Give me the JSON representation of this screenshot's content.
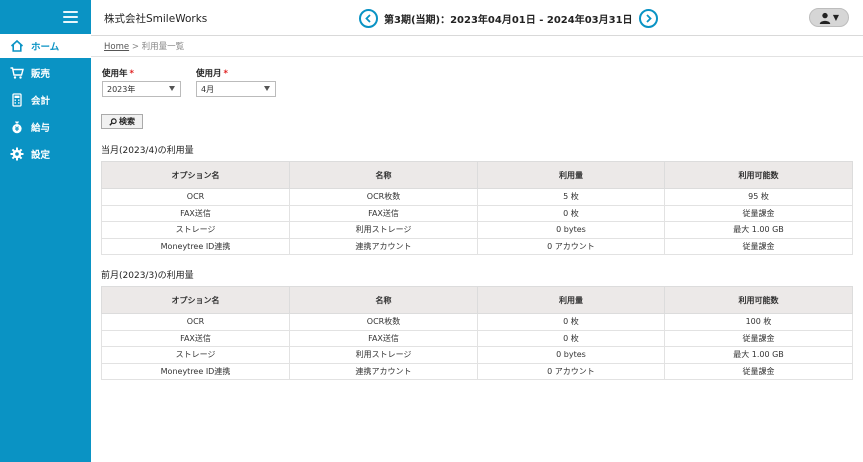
{
  "header": {
    "company": "株式会社SmileWorks",
    "period": "第3期(当期)：2023年04月01日 - 2024年03月31日"
  },
  "sidebar": {
    "items": [
      {
        "label": "ホーム",
        "icon": "home-icon"
      },
      {
        "label": "販売",
        "icon": "cart-icon"
      },
      {
        "label": "会計",
        "icon": "calculator-icon"
      },
      {
        "label": "給与",
        "icon": "money-bag-icon"
      },
      {
        "label": "設定",
        "icon": "gear-icon"
      }
    ],
    "active_index": 0
  },
  "breadcrumb": {
    "home": "Home",
    "separator": ">",
    "current": "利用量一覧"
  },
  "form": {
    "year_label": "使用年",
    "year_value": "2023年",
    "month_label": "使用月",
    "month_value": "4月",
    "required_mark": "*",
    "search_label": "検索"
  },
  "current_month": {
    "title": "当月(2023/4)の利用量",
    "headers": [
      "オプション名",
      "名称",
      "利用量",
      "利用可能数"
    ],
    "rows": [
      [
        "OCR",
        "OCR枚数",
        "5 枚",
        "95 枚"
      ],
      [
        "FAX送信",
        "FAX送信",
        "0 枚",
        "従量課金"
      ],
      [
        "ストレージ",
        "利用ストレージ",
        "0 bytes",
        "最大 1.00 GB"
      ],
      [
        "Moneytree ID連携",
        "連携アカウント",
        "0 アカウント",
        "従量課金"
      ]
    ]
  },
  "previous_month": {
    "title": "前月(2023/3)の利用量",
    "headers": [
      "オプション名",
      "名称",
      "利用量",
      "利用可能数"
    ],
    "rows": [
      [
        "OCR",
        "OCR枚数",
        "0 枚",
        "100 枚"
      ],
      [
        "FAX送信",
        "FAX送信",
        "0 枚",
        "従量課金"
      ],
      [
        "ストレージ",
        "利用ストレージ",
        "0 bytes",
        "最大 1.00 GB"
      ],
      [
        "Moneytree ID連携",
        "連携アカウント",
        "0 アカウント",
        "従量課金"
      ]
    ]
  },
  "colors": {
    "brand": "#0a93c4",
    "required": "#e02020",
    "table_header_bg": "#ece9e8"
  }
}
